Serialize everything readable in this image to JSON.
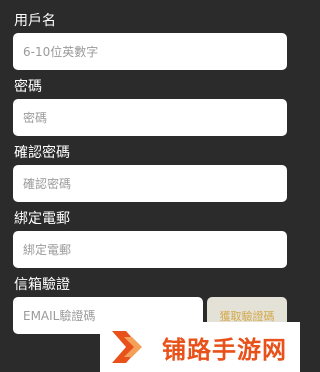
{
  "form": {
    "username": {
      "label": "用戶名",
      "placeholder": "6-10位英數字"
    },
    "password": {
      "label": "密碼",
      "placeholder": "密碼"
    },
    "confirm_password": {
      "label": "確認密碼",
      "placeholder": "確認密碼"
    },
    "email": {
      "label": "綁定電郵",
      "placeholder": "綁定電郵"
    },
    "email_verification": {
      "label": "信箱驗證",
      "placeholder": "EMAIL驗證碼",
      "button_label": "獲取驗證碼"
    }
  },
  "watermark": {
    "text": "铺路手游网",
    "logo_icon": "double-chevron-logo-icon"
  },
  "colors": {
    "background": "#2b2b2b",
    "accent": "#d3a94a",
    "watermark": "#e8521a"
  }
}
